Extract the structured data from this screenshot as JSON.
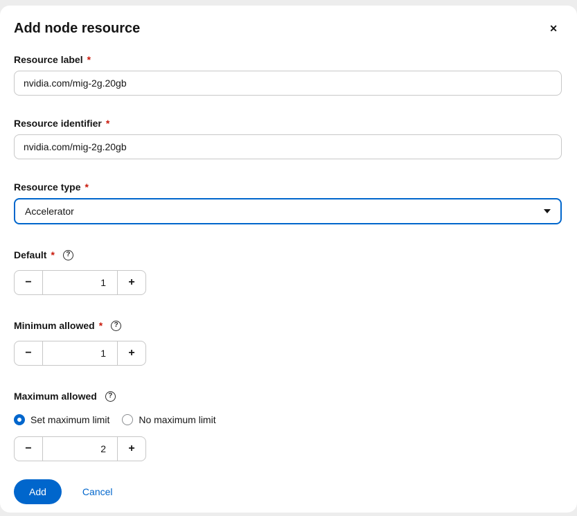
{
  "modal": {
    "title": "Add node resource"
  },
  "icons": {
    "close": "✕",
    "minus": "−",
    "plus": "+",
    "help": "?"
  },
  "form": {
    "resource_label": {
      "label": "Resource label",
      "required": "*",
      "value": "nvidia.com/mig-2g.20gb"
    },
    "resource_identifier": {
      "label": "Resource identifier",
      "required": "*",
      "value": "nvidia.com/mig-2g.20gb"
    },
    "resource_type": {
      "label": "Resource type",
      "required": "*",
      "selected": "Accelerator"
    },
    "default": {
      "label": "Default",
      "required": "*",
      "value": "1"
    },
    "minimum_allowed": {
      "label": "Minimum allowed",
      "required": "*",
      "value": "1"
    },
    "maximum_allowed": {
      "label": "Maximum allowed",
      "value": "2",
      "options": [
        {
          "label": "Set maximum limit",
          "selected": true
        },
        {
          "label": "No maximum limit",
          "selected": false
        }
      ]
    }
  },
  "actions": {
    "add": "Add",
    "cancel": "Cancel"
  },
  "colors": {
    "primary": "#0066cc",
    "danger": "#c9190b"
  }
}
